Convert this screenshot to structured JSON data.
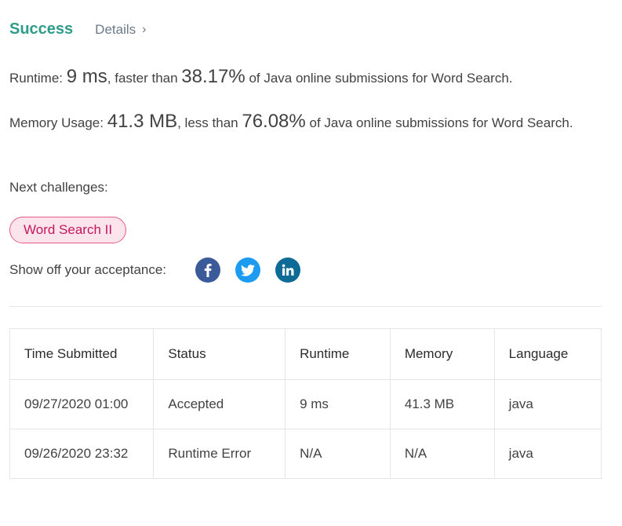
{
  "result": {
    "status": "Success",
    "details_label": "Details",
    "details_chevron": "›"
  },
  "runtime": {
    "label": "Runtime:",
    "value": "9 ms",
    "mid_text": ", faster than",
    "percent": "38.17%",
    "suffix": "of Java online submissions for Word Search."
  },
  "memory": {
    "label": "Memory Usage:",
    "value": "41.3 MB",
    "mid_text": ", less than",
    "percent": "76.08%",
    "suffix": "of Java online submissions for Word Search."
  },
  "next_challenges": {
    "label": "Next challenges:",
    "items": [
      "Word Search II"
    ]
  },
  "share": {
    "label": "Show off your acceptance:",
    "icons": [
      "facebook-icon",
      "twitter-icon",
      "linkedin-icon"
    ],
    "colors": {
      "facebook": "#3b5a99",
      "twitter": "#1d9bf0",
      "linkedin": "#0e6b96"
    }
  },
  "submissions": {
    "headers": [
      "Time Submitted",
      "Status",
      "Runtime",
      "Memory",
      "Language"
    ],
    "rows": [
      {
        "time": "09/27/2020 01:00",
        "status": "Accepted",
        "runtime": "9 ms",
        "memory": "41.3 MB",
        "language": "java"
      },
      {
        "time": "09/26/2020 23:32",
        "status": "Runtime Error",
        "runtime": "N/A",
        "memory": "N/A",
        "language": "java"
      }
    ]
  },
  "colors": {
    "success": "#2f9c8a",
    "error": "#c62828",
    "tag_bg": "#fce4ec",
    "tag_text": "#c2185b"
  }
}
